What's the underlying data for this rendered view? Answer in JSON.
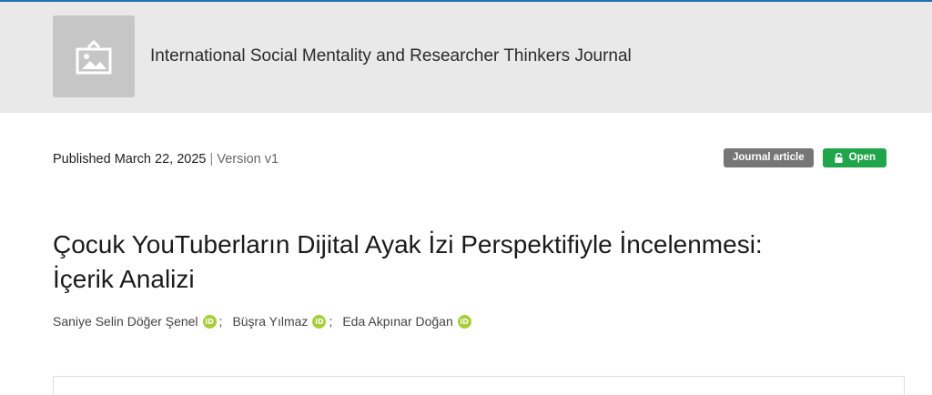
{
  "header": {
    "journal_title": "International Social Mentality and Researcher Thinkers Journal",
    "logo_icon": "image-placeholder-icon"
  },
  "publication": {
    "published_label": "Published March 22, 2025",
    "separator": "|",
    "version": "Version v1"
  },
  "badges": {
    "type": "Journal article",
    "access": "Open",
    "access_icon": "unlock-icon"
  },
  "record": {
    "title_line1": "Çocuk YouTuberların Dijital Ayak İzi Perspektifiyle İncelenmesi:",
    "title_line2": "İçerik Analizi"
  },
  "authors": [
    {
      "name": "Saniye Selin Döğer Şenel",
      "orcid_mark": "iD"
    },
    {
      "name": "Büşra Yılmaz",
      "orcid_mark": "iD"
    },
    {
      "name": "Eda Akpınar Doğan",
      "orcid_mark": "iD"
    }
  ],
  "author_separator": ";",
  "colors": {
    "accent_line": "#1f6fb5",
    "open_badge": "#21a54a",
    "type_badge": "#767676",
    "orcid": "#a6ce39"
  }
}
